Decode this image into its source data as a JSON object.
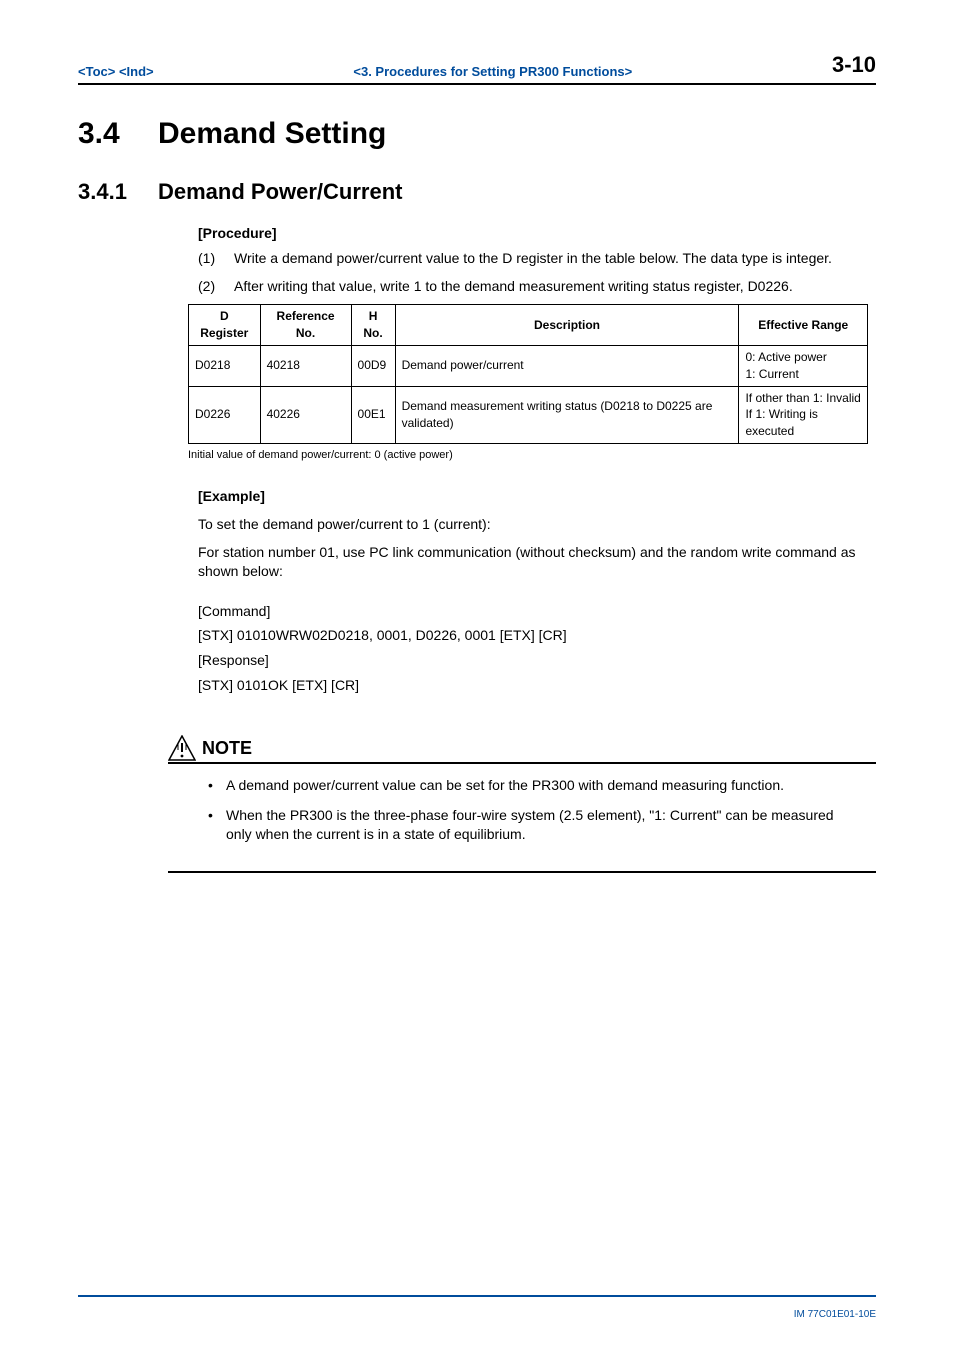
{
  "header": {
    "toc": "<Toc>",
    "ind": "<Ind>",
    "center": "<3.  Procedures for Setting PR300 Functions>",
    "page": "3-10"
  },
  "section": {
    "num": "3.4",
    "title": "Demand Setting"
  },
  "subsection": {
    "num": "3.4.1",
    "title": "Demand Power/Current"
  },
  "procedure": {
    "label": "[Procedure]",
    "items": [
      {
        "num": "(1)",
        "text": "Write a demand power/current value to the D register in the table below. The data type is integer."
      },
      {
        "num": "(2)",
        "text": "After writing that value, write 1 to the demand measurement writing status register, D0226."
      }
    ]
  },
  "table": {
    "headers": [
      "D Register",
      "Reference No.",
      "H No.",
      "Description",
      "Effective Range"
    ],
    "rows": [
      {
        "dreg": "D0218",
        "ref": "40218",
        "hno": "00D9",
        "desc": "Demand power/current",
        "range": "0: Active power\n1: Current"
      },
      {
        "dreg": "D0226",
        "ref": "40226",
        "hno": "00E1",
        "desc": "Demand measurement writing status (D0218 to D0225 are validated)",
        "range": "If other than 1: Invalid\nIf 1: Writing is executed"
      }
    ],
    "footnote": "Initial value of demand power/current: 0 (active power)"
  },
  "example": {
    "label": "[Example]",
    "intro1": "To set the demand power/current to 1 (current):",
    "intro2": "For station number 01, use PC link communication (without checksum) and the random write command as shown below:",
    "cmd_label": "[Command]",
    "cmd_line": "[STX] 01010WRW02D0218, 0001, D0226, 0001 [ETX] [CR]",
    "resp_label": "[Response]",
    "resp_line": "[STX] 0101OK [ETX] [CR]"
  },
  "note": {
    "title": "NOTE",
    "bullets": [
      "A demand power/current value can be set for the PR300 with demand measuring function.",
      "When the PR300 is the three-phase four-wire system (2.5 element), \"1: Current\" can be measured only when the current is in a state of equilibrium."
    ]
  },
  "footer": {
    "doc": "IM 77C01E01-10E"
  }
}
